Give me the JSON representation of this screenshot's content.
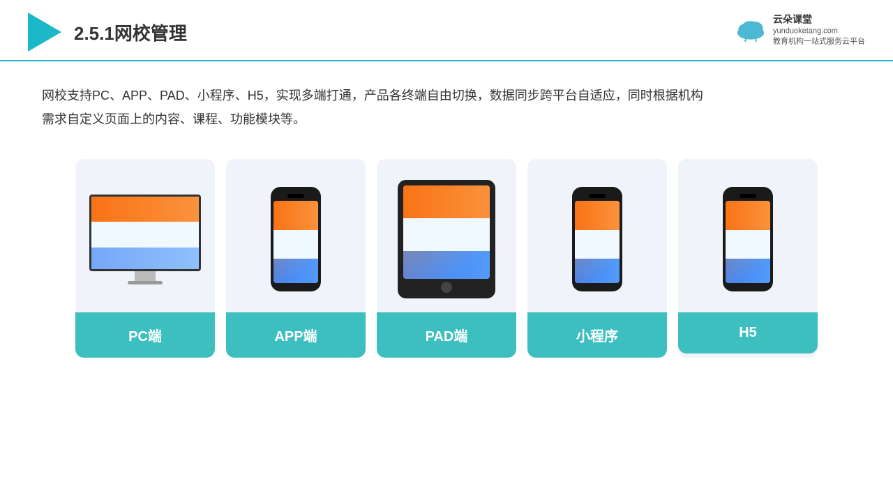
{
  "header": {
    "title": "2.5.1网校管理",
    "brand_name": "云朵课堂",
    "brand_url": "yunduoketang.com",
    "brand_tagline": "教育机构一站\n式服务云平台"
  },
  "description": {
    "text": "网校支持PC、APP、PAD、小程序、H5，实现多端打通，产品各终端自由切换，数据同步跨平台自适应，同时根据机构需求自定义页面上的内容、课程、功能模块等。"
  },
  "cards": [
    {
      "id": "pc",
      "label": "PC端"
    },
    {
      "id": "app",
      "label": "APP端"
    },
    {
      "id": "pad",
      "label": "PAD端"
    },
    {
      "id": "mini",
      "label": "小程序"
    },
    {
      "id": "h5",
      "label": "H5"
    }
  ]
}
